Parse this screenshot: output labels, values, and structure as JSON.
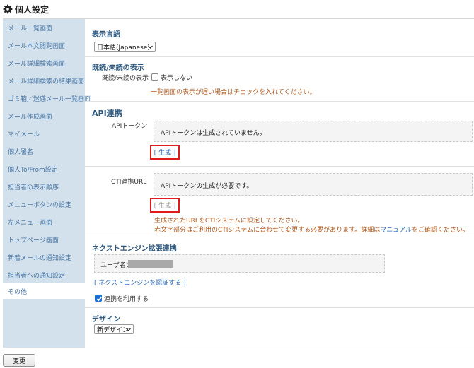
{
  "header": {
    "title": "個人設定",
    "icon": "gear-icon"
  },
  "sidebar": {
    "items": [
      {
        "label": "メール一覧画面"
      },
      {
        "label": "メール本文閲覧画面"
      },
      {
        "label": "メール詳細検索画面"
      },
      {
        "label": "メール詳細検索の結果画面"
      },
      {
        "label": "ゴミ箱／迷惑メール一覧画面"
      },
      {
        "label": "メール作成画面"
      },
      {
        "label": "マイメール"
      },
      {
        "label": "個人署名"
      },
      {
        "label": "個人To/From設定"
      },
      {
        "label": "担当者の表示順序"
      },
      {
        "label": "メニューボタンの設定"
      },
      {
        "label": "左メニュー画面"
      },
      {
        "label": "トップページ画面"
      },
      {
        "label": "新着メールの通知設定"
      },
      {
        "label": "担当者への通知設定"
      },
      {
        "label": "その他",
        "active": true
      }
    ]
  },
  "language": {
    "title": "表示言語",
    "selected": "日本語(Japanese)"
  },
  "read_status": {
    "title": "既読/未読の表示",
    "label": "既読/未読の表示",
    "checkbox_label": "表示しない",
    "checked": false,
    "note": "一覧画面の表示が遅い場合はチェックを入れてください。"
  },
  "api": {
    "title": "API連携",
    "token_label": "APIトークン",
    "token_value": "APIトークンは生成されていません。",
    "generate_label": "[ 生成 ]",
    "cti_label": "CTI連携URL",
    "cti_value": "APIトークンの生成が必要です。",
    "cti_generate_label": "[ 生成 ]",
    "note1": "生成されたURLをCTIシステムに設定してください。",
    "note2_before": "赤文字部分はご利用のCTIシステムに合わせて変更する必要があります。詳細は",
    "note2_link": "マニュアル",
    "note2_after": "をご確認ください。"
  },
  "next_engine": {
    "title": "ネクストエンジン拡張連携",
    "user_label": "ユーザ名：",
    "auth_link": "[ ネクストエンジンを認証する ]",
    "use_label": "連携を利用する",
    "use_checked": true
  },
  "design": {
    "title": "デザイン",
    "selected": "新デザイン"
  },
  "footer": {
    "change_label": "変更"
  },
  "colors": {
    "accent_red": "#e01b1b",
    "link_blue": "#2f6bb8",
    "sidebar_bg": "#d3e1ec"
  }
}
